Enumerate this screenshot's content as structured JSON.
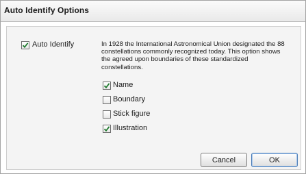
{
  "dialog": {
    "title": "Auto Identify Options"
  },
  "options": {
    "auto_identify": {
      "label": "Auto Identify",
      "checked": true
    },
    "description": "In 1928 the International Astronomical Union designated the 88 constellations commonly recognized today. This option shows the agreed upon boundaries of these standardized constellations.",
    "items": [
      {
        "label": "Name",
        "checked": true
      },
      {
        "label": "Boundary",
        "checked": false
      },
      {
        "label": "Stick figure",
        "checked": false
      },
      {
        "label": "Illustration",
        "checked": true
      }
    ]
  },
  "buttons": {
    "cancel": "Cancel",
    "ok": "OK"
  },
  "colors": {
    "check": "#1f7a2e"
  }
}
